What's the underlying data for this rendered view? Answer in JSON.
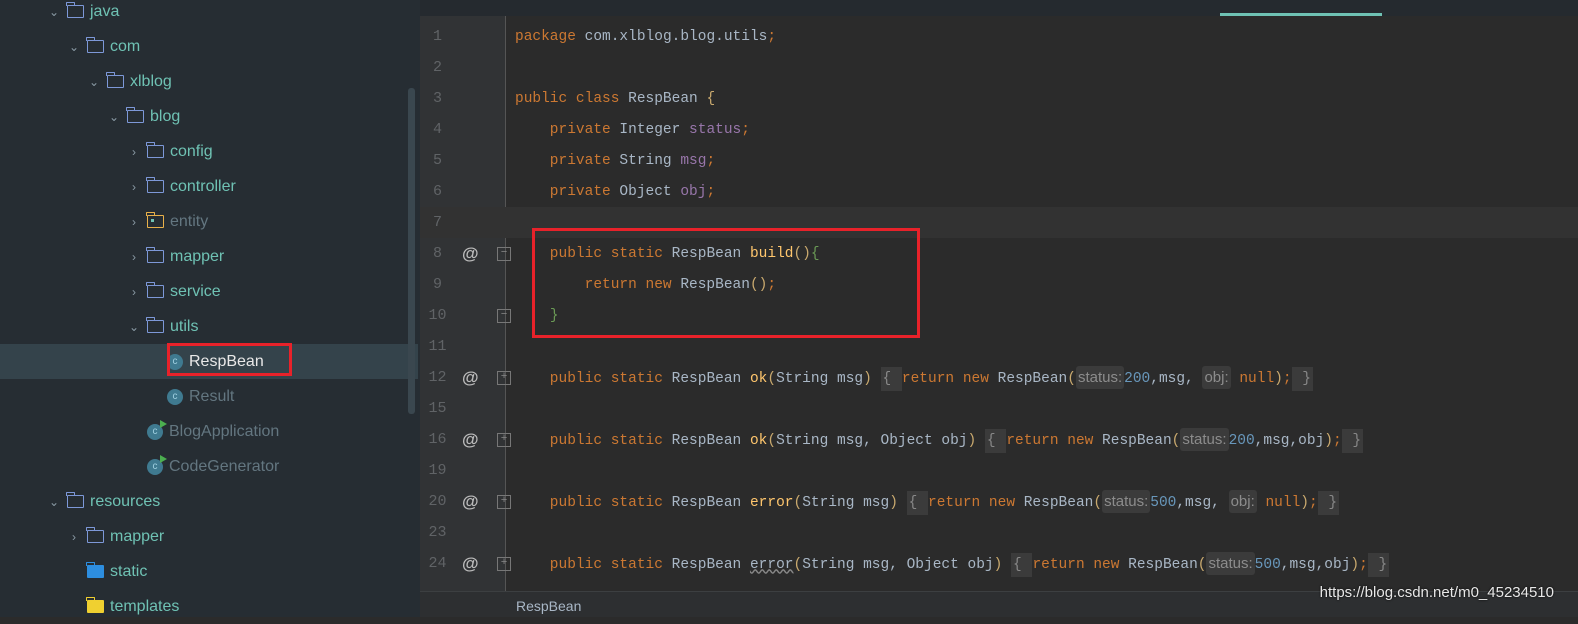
{
  "sidebar": {
    "items": [
      {
        "label": "java",
        "depth": 0,
        "chevron": "down",
        "icon": "folder-icon"
      },
      {
        "label": "com",
        "depth": 1,
        "chevron": "down",
        "icon": "folder-icon"
      },
      {
        "label": "xlblog",
        "depth": 2,
        "chevron": "down",
        "icon": "folder-icon"
      },
      {
        "label": "blog",
        "depth": 3,
        "chevron": "down",
        "icon": "folder-icon"
      },
      {
        "label": "config",
        "depth": 4,
        "chevron": "right",
        "icon": "folder-icon"
      },
      {
        "label": "controller",
        "depth": 4,
        "chevron": "right",
        "icon": "folder-icon"
      },
      {
        "label": "entity",
        "depth": 4,
        "chevron": "right",
        "icon": "package-folder-icon",
        "dim": true
      },
      {
        "label": "mapper",
        "depth": 4,
        "chevron": "right",
        "icon": "folder-icon"
      },
      {
        "label": "service",
        "depth": 4,
        "chevron": "right",
        "icon": "folder-icon"
      },
      {
        "label": "utils",
        "depth": 4,
        "chevron": "down",
        "icon": "folder-icon"
      },
      {
        "label": "RespBean",
        "depth": 5,
        "icon": "class-icon",
        "selected": true
      },
      {
        "label": "Result",
        "depth": 5,
        "icon": "class-icon",
        "dim": true
      },
      {
        "label": "BlogApplication",
        "depth": 4,
        "icon": "spring-boot-class-icon",
        "dim": true
      },
      {
        "label": "CodeGenerator",
        "depth": 4,
        "icon": "runnable-class-icon",
        "dim": true
      },
      {
        "label": "resources",
        "depth": 0,
        "chevron": "down",
        "icon": "folder-icon"
      },
      {
        "label": "mapper",
        "depth": 1,
        "chevron": "right",
        "icon": "folder-icon"
      },
      {
        "label": "static",
        "depth": 1,
        "icon": "web-folder-icon"
      },
      {
        "label": "templates",
        "depth": 1,
        "icon": "templates-folder-icon"
      }
    ]
  },
  "editor": {
    "lines": [
      {
        "n": "1",
        "tokens": [
          [
            "package ",
            "kw"
          ],
          [
            "com.xlblog.blog.utils",
            "pl"
          ],
          [
            ";",
            "kw"
          ]
        ]
      },
      {
        "n": "2",
        "tokens": []
      },
      {
        "n": "3",
        "tokens": [
          [
            "public class ",
            "kw"
          ],
          [
            "RespBean ",
            "ty"
          ],
          [
            "{",
            "br"
          ]
        ]
      },
      {
        "n": "4",
        "tokens": [
          [
            "    private ",
            "kw"
          ],
          [
            "Integer ",
            "ty"
          ],
          [
            "status",
            "fld"
          ],
          [
            ";",
            "kw"
          ]
        ]
      },
      {
        "n": "5",
        "tokens": [
          [
            "    private ",
            "kw"
          ],
          [
            "String ",
            "ty"
          ],
          [
            "msg",
            "fld"
          ],
          [
            ";",
            "kw"
          ]
        ]
      },
      {
        "n": "6",
        "tokens": [
          [
            "    private ",
            "kw"
          ],
          [
            "Object ",
            "ty"
          ],
          [
            "obj",
            "fld"
          ],
          [
            ";",
            "kw"
          ]
        ]
      },
      {
        "n": "7",
        "tokens": [],
        "current": true
      },
      {
        "n": "8",
        "at": true,
        "fold": "-",
        "tokens": [
          [
            "    public static ",
            "kw"
          ],
          [
            "RespBean ",
            "ty"
          ],
          [
            "build",
            "fn"
          ],
          [
            "()",
            "br"
          ],
          [
            "{",
            "grn"
          ]
        ]
      },
      {
        "n": "9",
        "tokens": [
          [
            "        return new ",
            "kw"
          ],
          [
            "RespBean",
            "ty"
          ],
          [
            "()",
            "br"
          ],
          [
            ";",
            "kw"
          ]
        ]
      },
      {
        "n": "10",
        "fold": "-",
        "tokens": [
          [
            "    ",
            "pl"
          ],
          [
            "}",
            "grn"
          ]
        ]
      },
      {
        "n": "11",
        "tokens": []
      },
      {
        "n": "12",
        "at": true,
        "fold": "+",
        "tokens": [
          [
            "    public static ",
            "kw"
          ],
          [
            "RespBean ",
            "ty"
          ],
          [
            "ok",
            "fn"
          ],
          [
            "(",
            "br"
          ],
          [
            "String msg",
            "ty"
          ],
          [
            ")",
            "br"
          ],
          [
            " ",
            "pl"
          ],
          [
            "{ ",
            "fold"
          ],
          [
            "return new ",
            "kw"
          ],
          [
            "RespBean",
            "ty"
          ],
          [
            "(",
            "br"
          ],
          [
            "status:",
            "hint"
          ],
          [
            "200",
            "num"
          ],
          [
            ",msg, ",
            "pl"
          ],
          [
            "obj:",
            "hint"
          ],
          [
            " null",
            "kw"
          ],
          [
            ")",
            "br"
          ],
          [
            ";",
            "kw"
          ],
          [
            " }",
            "fold"
          ]
        ]
      },
      {
        "n": "15",
        "tokens": []
      },
      {
        "n": "16",
        "at": true,
        "fold": "+",
        "tokens": [
          [
            "    public static ",
            "kw"
          ],
          [
            "RespBean ",
            "ty"
          ],
          [
            "ok",
            "fn"
          ],
          [
            "(",
            "br"
          ],
          [
            "String msg, Object obj",
            "ty"
          ],
          [
            ")",
            "br"
          ],
          [
            " ",
            "pl"
          ],
          [
            "{ ",
            "fold"
          ],
          [
            "return new ",
            "kw"
          ],
          [
            "RespBean",
            "ty"
          ],
          [
            "(",
            "br"
          ],
          [
            "status:",
            "hint"
          ],
          [
            "200",
            "num"
          ],
          [
            ",msg,obj",
            "pl"
          ],
          [
            ")",
            "br"
          ],
          [
            ";",
            "kw"
          ],
          [
            " }",
            "fold"
          ]
        ]
      },
      {
        "n": "19",
        "tokens": []
      },
      {
        "n": "20",
        "at": true,
        "fold": "+",
        "tokens": [
          [
            "    public static ",
            "kw"
          ],
          [
            "RespBean ",
            "ty"
          ],
          [
            "error",
            "fn"
          ],
          [
            "(",
            "br"
          ],
          [
            "String msg",
            "ty"
          ],
          [
            ")",
            "br"
          ],
          [
            " ",
            "pl"
          ],
          [
            "{ ",
            "fold"
          ],
          [
            "return new ",
            "kw"
          ],
          [
            "RespBean",
            "ty"
          ],
          [
            "(",
            "br"
          ],
          [
            "status:",
            "hint"
          ],
          [
            "500",
            "num"
          ],
          [
            ",msg, ",
            "pl"
          ],
          [
            "obj:",
            "hint"
          ],
          [
            " null",
            "kw"
          ],
          [
            ")",
            "br"
          ],
          [
            ";",
            "kw"
          ],
          [
            " }",
            "fold"
          ]
        ]
      },
      {
        "n": "23",
        "tokens": []
      },
      {
        "n": "24",
        "at": true,
        "fold": "+",
        "tokens": [
          [
            "    public static ",
            "kw"
          ],
          [
            "RespBean ",
            "ty"
          ],
          [
            "error",
            "ty"
          ],
          [
            "(",
            "br"
          ],
          [
            "String msg, Object obj",
            "ty"
          ],
          [
            ")",
            "br"
          ],
          [
            " ",
            "pl"
          ],
          [
            "{ ",
            "fold"
          ],
          [
            "return new ",
            "kw"
          ],
          [
            "RespBean",
            "ty"
          ],
          [
            "(",
            "br"
          ],
          [
            "status:",
            "hint"
          ],
          [
            "500",
            "num"
          ],
          [
            ",msg,obj",
            "pl"
          ],
          [
            ")",
            "br"
          ],
          [
            ";",
            "kw"
          ],
          [
            " }",
            "fold"
          ]
        ]
      }
    ]
  },
  "status": {
    "breadcrumb": "RespBean",
    "watermark": "https://blog.csdn.net/m0_45234510"
  },
  "colors": {
    "highlight_box": "#e8222a",
    "accent": "#6fc2b4"
  }
}
